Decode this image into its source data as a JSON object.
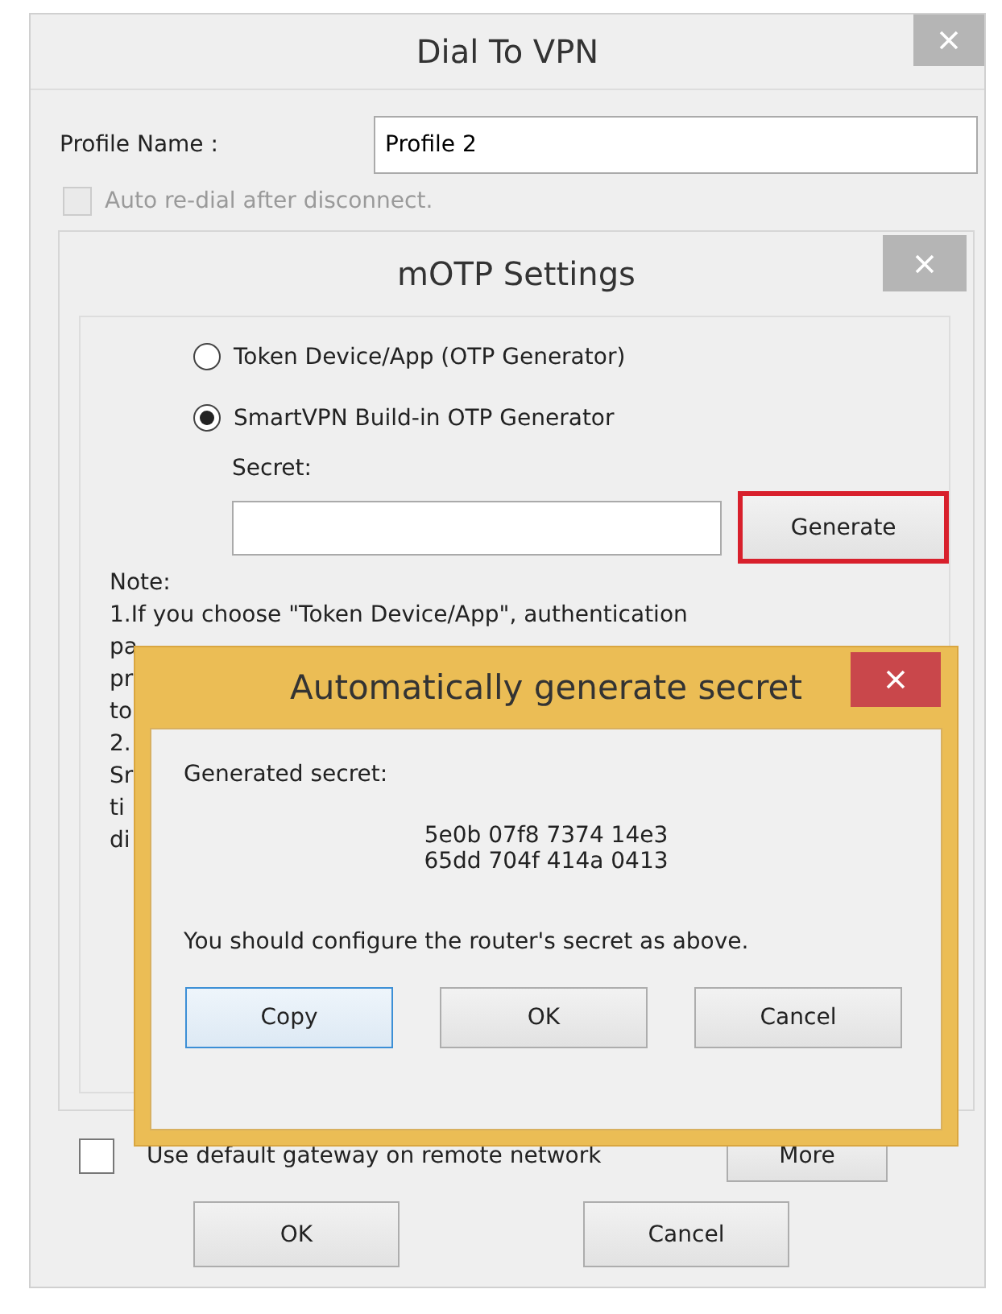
{
  "main_window": {
    "title": "Dial To VPN",
    "profile_name": {
      "label": "Profile Name :",
      "value": "Profile 2"
    },
    "auto_redial": {
      "label": "Auto re-dial after disconnect.",
      "checked": false,
      "disabled": true
    },
    "default_gateway": {
      "label": "Use default gateway on remote network",
      "checked": false
    },
    "more_button": "More",
    "buttons": [
      "OK",
      "Cancel"
    ]
  },
  "motp_window": {
    "title": "mOTP Settings",
    "options": [
      {
        "label": "Token Device/App (OTP Generator)",
        "selected": false
      },
      {
        "label": "SmartVPN Build-in OTP Generator",
        "selected": true
      }
    ],
    "secret_label": "Secret:",
    "generate_button": {
      "label": "Generate",
      "highlighted": true
    },
    "note_heading": "Note:",
    "note_lines": [
      "1.If you choose \"Token Device/App\", authentication",
      "pa",
      "pr",
      "to",
      "2.",
      "Sr",
      "ti",
      "di"
    ]
  },
  "secret_dialog": {
    "title": "Automatically generate secret",
    "heading": "Generated secret:",
    "secret_lines": [
      "5e0b 07f8 7374 14e3",
      "65dd 704f 414a 0413"
    ],
    "message": "You should configure the router's secret as above.",
    "buttons": [
      {
        "label": "Copy",
        "focused": true
      },
      {
        "label": "OK",
        "focused": false
      },
      {
        "label": "Cancel",
        "focused": false
      }
    ]
  }
}
